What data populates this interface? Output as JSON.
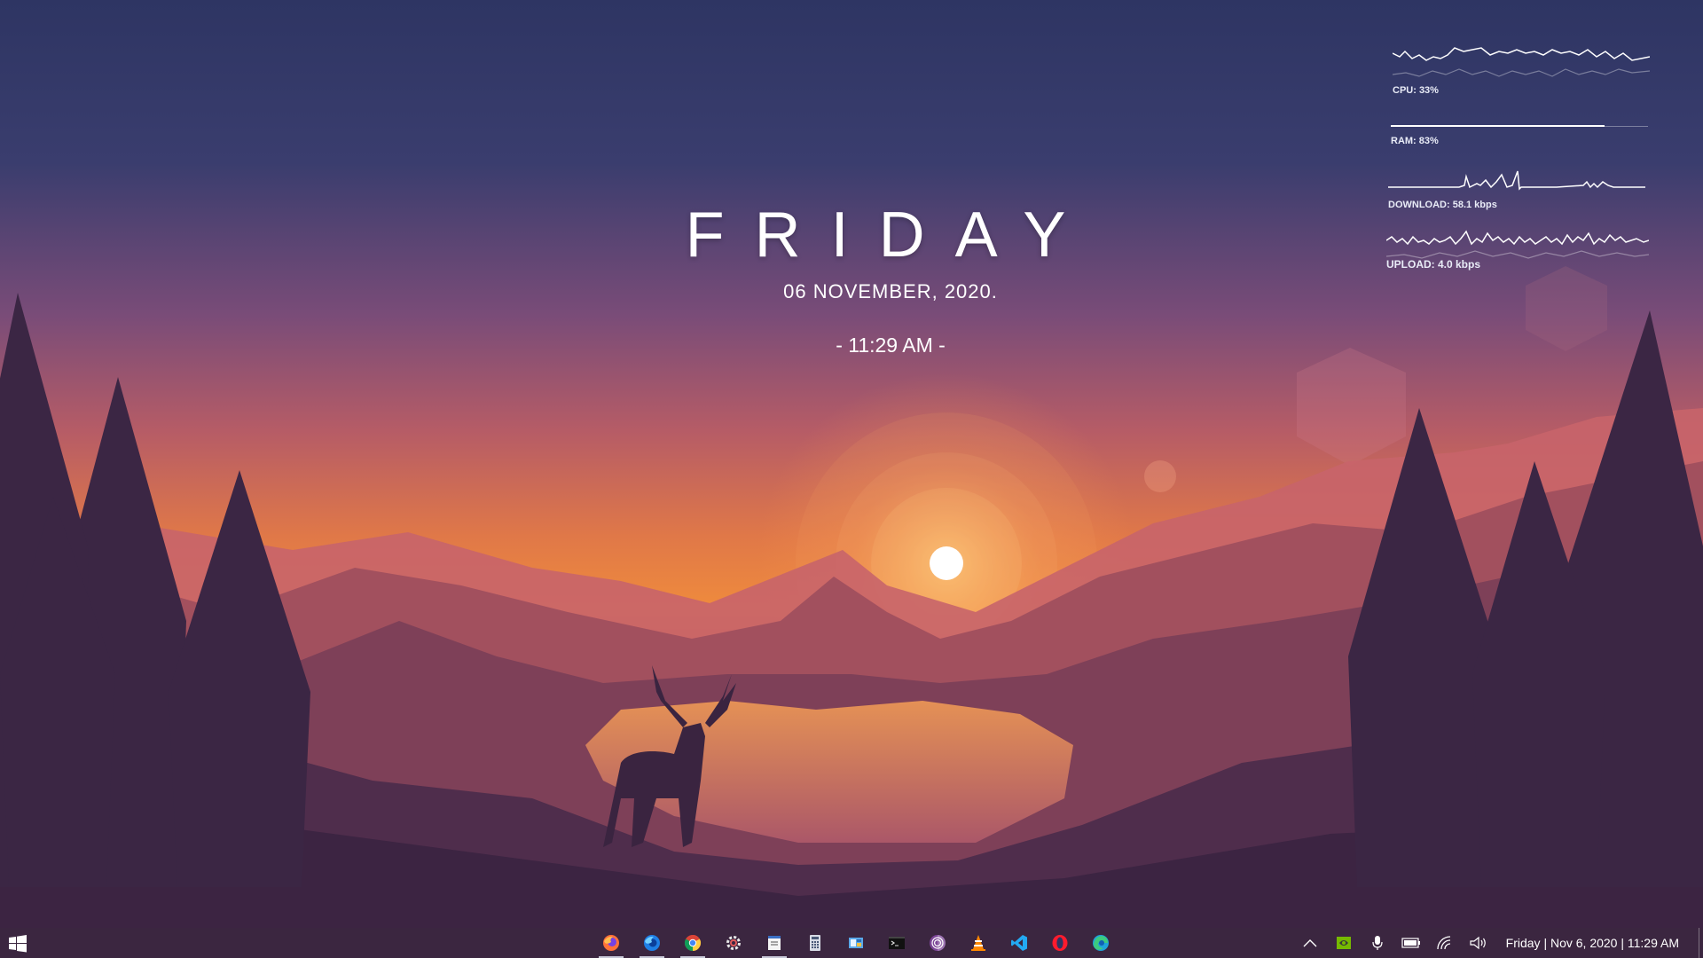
{
  "desktop": {
    "day": "FRIDAY",
    "date": "06  NOVEMBER,  2020.",
    "time": "- 11:29 AM -"
  },
  "widgets": {
    "cpu": {
      "label": "CPU: 33%",
      "percent": 33
    },
    "ram": {
      "label": "RAM: 83%",
      "percent": 83
    },
    "download": {
      "label": "DOWNLOAD: 58.1 kbps"
    },
    "upload": {
      "label": "UPLOAD: 4.0 kbps"
    }
  },
  "taskbar": {
    "apps": [
      {
        "name": "firefox",
        "icon": "firefox-icon",
        "running": true
      },
      {
        "name": "firefox-developer",
        "icon": "firefox-dev-icon",
        "running": true
      },
      {
        "name": "chrome",
        "icon": "chrome-icon",
        "running": true
      },
      {
        "name": "settings",
        "icon": "gear-icon",
        "running": false
      },
      {
        "name": "notepad",
        "icon": "notepad-icon",
        "running": true
      },
      {
        "name": "calculator",
        "icon": "calculator-icon",
        "running": false
      },
      {
        "name": "control-panel",
        "icon": "control-panel-icon",
        "running": false
      },
      {
        "name": "terminal",
        "icon": "terminal-icon",
        "running": false
      },
      {
        "name": "tor-browser",
        "icon": "tor-icon",
        "running": false
      },
      {
        "name": "vlc",
        "icon": "vlc-icon",
        "running": false
      },
      {
        "name": "vscode",
        "icon": "vscode-icon",
        "running": false
      },
      {
        "name": "opera",
        "icon": "opera-icon",
        "running": false
      },
      {
        "name": "edge",
        "icon": "edge-icon",
        "running": false
      }
    ],
    "tray_clock": "Friday | Nov 6, 2020 | 11:29 AM"
  }
}
